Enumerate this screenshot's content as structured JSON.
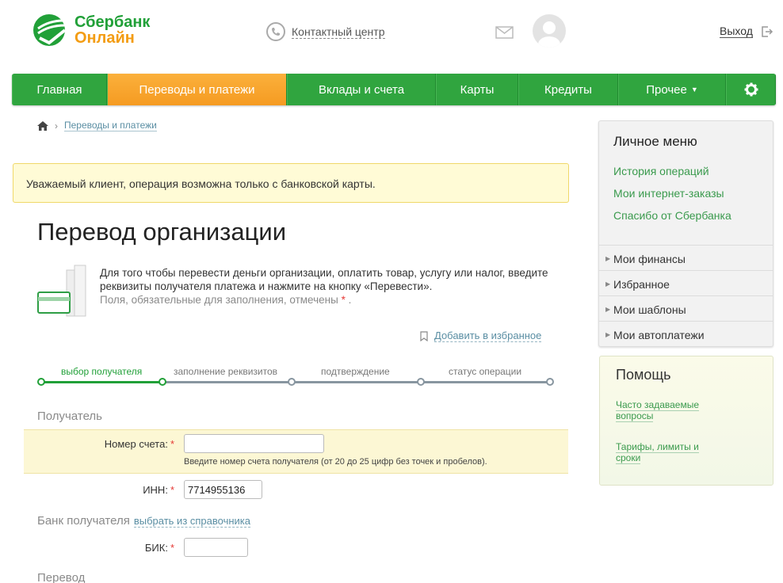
{
  "header": {
    "brand_line1": "Сбербанк",
    "brand_line2": "Онлайн",
    "contact_label": "Контактный центр",
    "logout_label": "Выход"
  },
  "nav": {
    "items": [
      {
        "label": "Главная"
      },
      {
        "label": "Переводы и платежи",
        "active": true
      },
      {
        "label": "Вклады и счета"
      },
      {
        "label": "Карты"
      },
      {
        "label": "Кредиты"
      },
      {
        "label": "Прочее"
      }
    ]
  },
  "breadcrumb": {
    "current": "Переводы и платежи"
  },
  "alert": {
    "text": "Уважаемый клиент, операция возможна только с банковской карты."
  },
  "page": {
    "title": "Перевод организации",
    "intro_text": "Для того чтобы перевести деньги организации, оплатить товар, услугу или налог, введите реквизиты получателя платежа и нажмите на кнопку «Перевести».",
    "required_hint": "Поля, обязательные для заполнения, отмечены",
    "required_star": "*",
    "required_dot": ".",
    "favorite_link": "Добавить в избранное"
  },
  "steps": [
    {
      "label": "выбор получателя",
      "state": "active"
    },
    {
      "label": "заполнение реквизитов",
      "state": "pending"
    },
    {
      "label": "подтверждение",
      "state": "pending"
    },
    {
      "label": "статус операции",
      "state": "pending"
    }
  ],
  "form": {
    "recipient_section": "Получатель",
    "account_label": "Номер счета:",
    "account_value": "",
    "account_hint": "Введите номер счета получателя (от 20 до 25 цифр без точек и пробелов).",
    "inn_label": "ИНН:",
    "inn_value": "7714955136",
    "bank_section": "Банк получателя",
    "bank_dict_link": "выбрать из справочника",
    "bik_label": "БИК:",
    "bik_value": "",
    "transfer_section": "Перевод",
    "required_star": "*"
  },
  "sidebar": {
    "menu_title": "Личное меню",
    "links": [
      {
        "label": "История операций"
      },
      {
        "label": "Мои интернет-заказы"
      },
      {
        "label": "Спасибо от Сбербанка"
      }
    ],
    "items": [
      {
        "label": "Мои финансы"
      },
      {
        "label": "Избранное"
      },
      {
        "label": "Мои шаблоны"
      },
      {
        "label": "Мои автоплатежи"
      }
    ],
    "help_title": "Помощь",
    "help_links": [
      {
        "label": "Часто задаваемые вопросы"
      },
      {
        "label": "Тарифы, лимиты и сроки"
      }
    ]
  },
  "colors": {
    "brand_green": "#21a038",
    "nav_green": "#30a53f",
    "nav_active_orange": "#f59b22",
    "alert_bg": "#fffbd6",
    "link_blue": "#5a8ea3"
  }
}
